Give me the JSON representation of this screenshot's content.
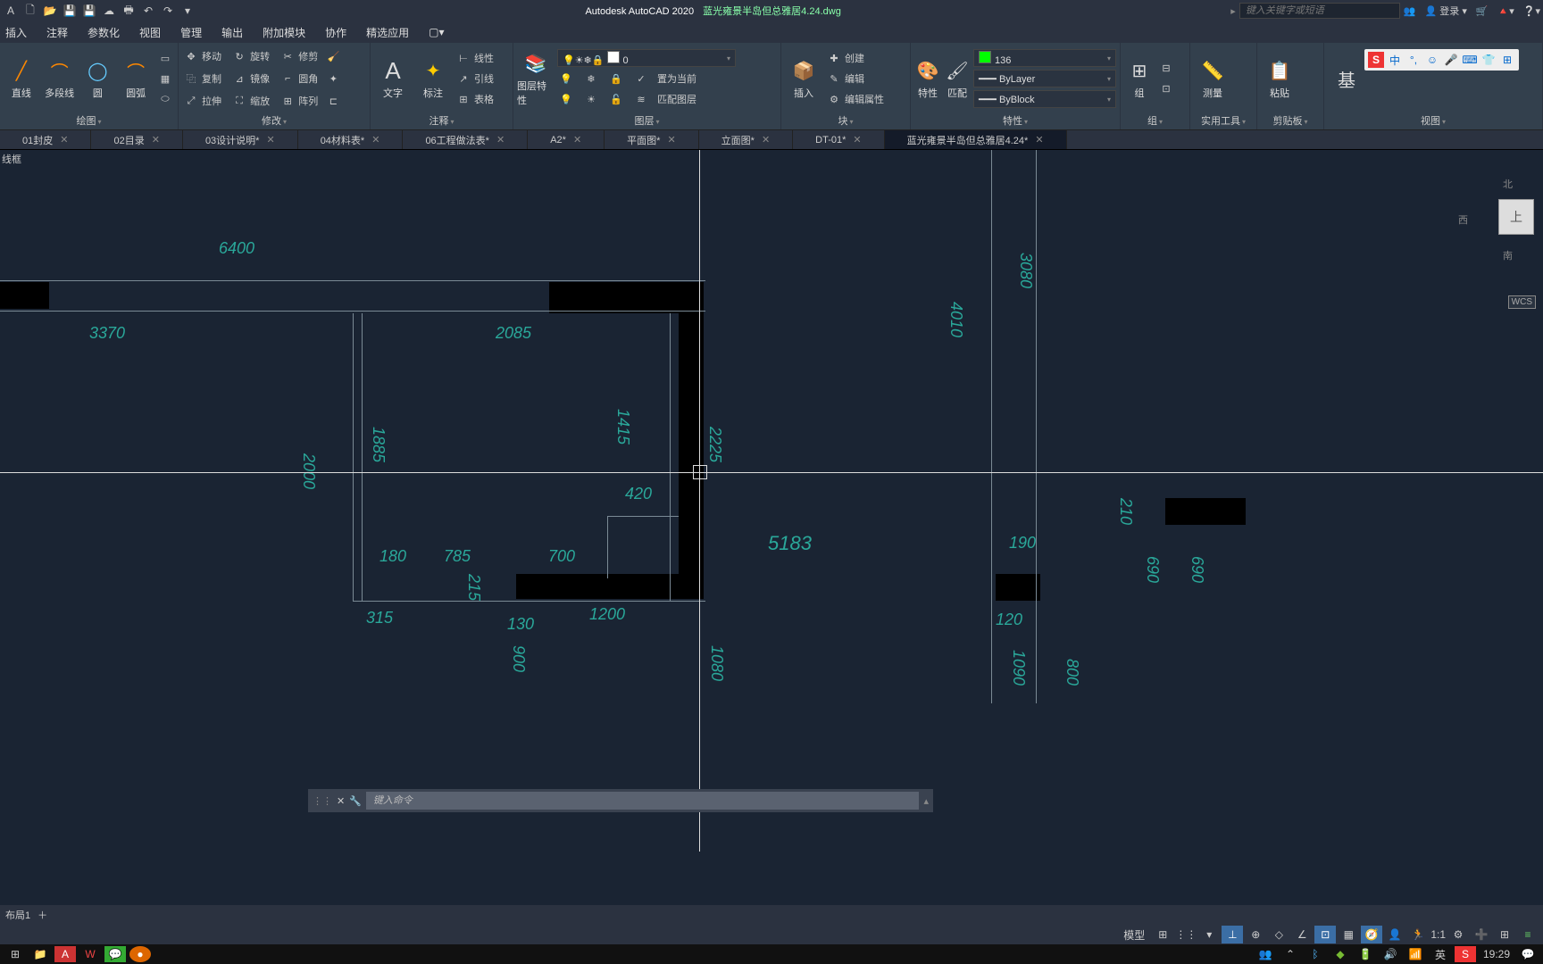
{
  "title": {
    "app": "Autodesk AutoCAD 2020",
    "file": "蓝光雍景半岛但总雅居4.24.dwg"
  },
  "search_placeholder": "键入关键字或短语",
  "login": "登录",
  "menu": [
    "插入",
    "注释",
    "参数化",
    "视图",
    "管理",
    "输出",
    "附加模块",
    "协作",
    "精选应用"
  ],
  "ribbon": {
    "draw": {
      "title": "绘图",
      "line": "直线",
      "poly": "多段线",
      "circle": "圆",
      "arc": "圆弧"
    },
    "modify": {
      "title": "修改",
      "move": "移动",
      "rotate": "旋转",
      "trim": "修剪",
      "copy": "复制",
      "mirror": "镜像",
      "fillet": "圆角",
      "stretch": "拉伸",
      "scale": "缩放",
      "array": "阵列"
    },
    "annot": {
      "title": "注释",
      "text": "文字",
      "dim": "标注",
      "linear": "线性",
      "leader": "引线",
      "table": "表格"
    },
    "layers": {
      "title": "图层",
      "prop": "图层特性",
      "current": "0",
      "setcur": "置为当前",
      "match": "匹配图层"
    },
    "block": {
      "title": "块",
      "insert": "插入",
      "create": "创建",
      "edit": "编辑",
      "editattr": "编辑属性"
    },
    "props": {
      "title": "特性",
      "props": "特性",
      "match": "匹配",
      "layer": "136",
      "bylayer": "ByLayer",
      "byblock": "ByBlock"
    },
    "group": {
      "title": "组",
      "group": "组"
    },
    "util": {
      "title": "实用工具",
      "measure": "测量"
    },
    "clip": {
      "title": "剪贴板",
      "paste": "粘贴"
    },
    "view": {
      "title": "视图"
    }
  },
  "tabs": [
    {
      "label": "01封皮",
      "dirty": false
    },
    {
      "label": "02目录",
      "dirty": false
    },
    {
      "label": "03设计说明*",
      "dirty": true
    },
    {
      "label": "04材料表*",
      "dirty": true
    },
    {
      "label": "06工程做法表*",
      "dirty": true
    },
    {
      "label": "A2*",
      "dirty": true
    },
    {
      "label": "平面图*",
      "dirty": true
    },
    {
      "label": "立面图*",
      "dirty": true
    },
    {
      "label": "DT-01*",
      "dirty": true
    },
    {
      "label": "蓝光雍景半岛但总雅居4.24*",
      "dirty": true,
      "active": true
    }
  ],
  "canvas_label": "线框",
  "dims": {
    "d6400": "6400",
    "d3370": "3370",
    "d2085": "2085",
    "d1415": "1415",
    "d2000": "2000",
    "d1885": "1885",
    "d180": "180",
    "d785": "785",
    "d700": "700",
    "d420": "420",
    "d1200": "1200",
    "d315": "315",
    "d215": "215",
    "d130": "130",
    "d5183": "5183",
    "d4010": "4010",
    "d2225": "2225",
    "d900": "900",
    "d3080": "3080",
    "d1080": "1080",
    "d120": "120",
    "d190": "190",
    "d210": "210",
    "d690": "690",
    "d1090": "1090",
    "d800": "800"
  },
  "viewcube": {
    "n": "北",
    "w": "西",
    "s": "南",
    "top": "上",
    "wcs": "WCS"
  },
  "cmd_placeholder": "键入命令",
  "layout": {
    "tab": "布局1"
  },
  "status": {
    "model": "模型",
    "scale": "1:1"
  },
  "ime": {
    "cn": "中"
  },
  "tray": {
    "ime": "英",
    "time": "19:29"
  }
}
